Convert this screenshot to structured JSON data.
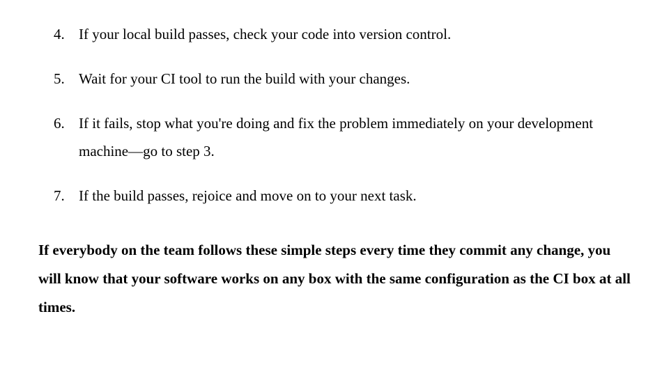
{
  "list": {
    "items": [
      {
        "n": "4.",
        "text": "If your local build passes, check your code into version control."
      },
      {
        "n": "5.",
        "text": "Wait for your CI tool to run the build with your changes."
      },
      {
        "n": "6.",
        "text": "If it fails, stop what you're doing and fix the problem immediately on your development machine—go to step 3."
      },
      {
        "n": "7.",
        "text": "If the build passes, rejoice and move on to your next task."
      }
    ]
  },
  "closing": "If everybody on the team follows these simple steps every time they commit any change, you will know that your software works on any box with the same configuration as the CI box at all times."
}
